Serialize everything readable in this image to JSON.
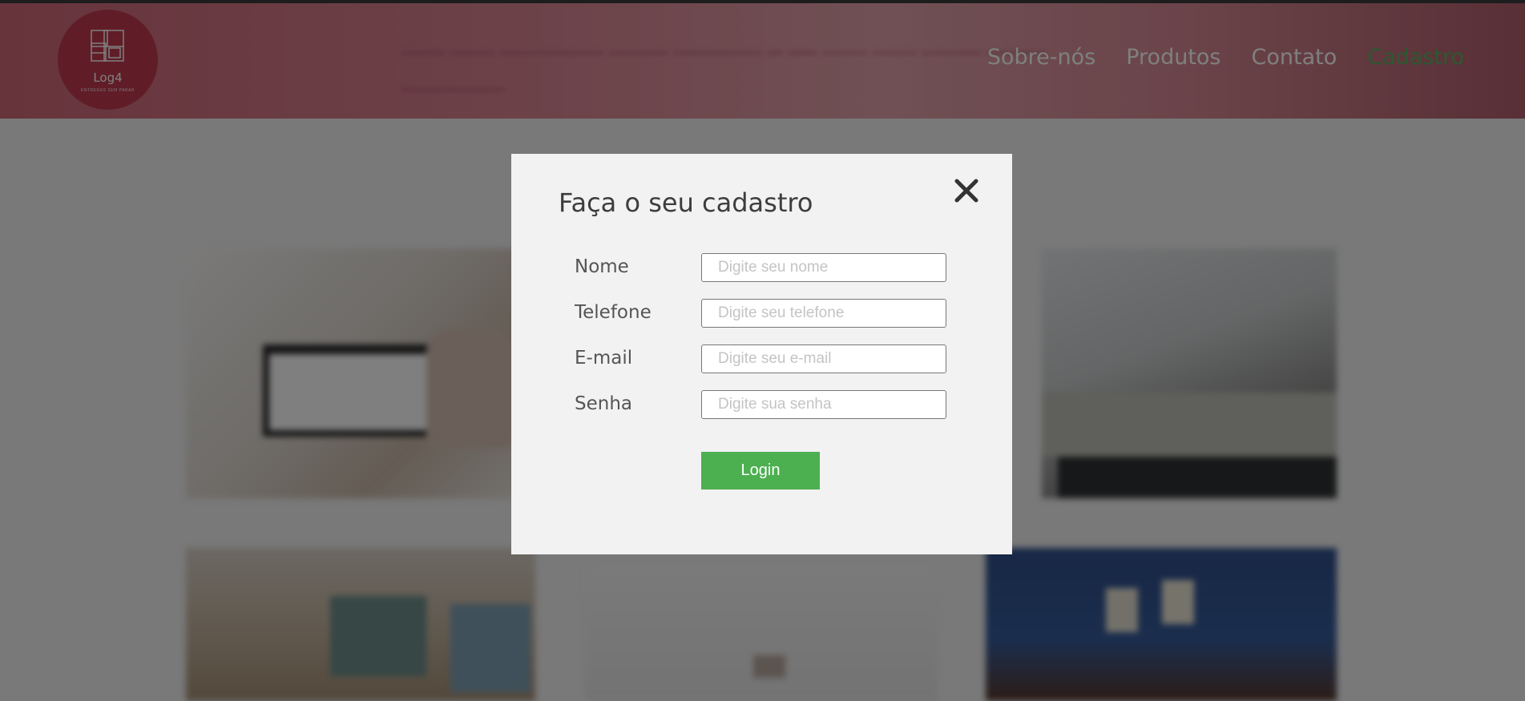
{
  "brand": {
    "name": "Log4",
    "tagline": "ENTREGAS SEM PARAR",
    "color": "#c13b4f"
  },
  "header": {
    "nav": [
      {
        "label": "Sobre-nós",
        "active": false
      },
      {
        "label": "Produtos",
        "active": false
      },
      {
        "label": "Contato",
        "active": false
      },
      {
        "label": "Cadastro",
        "active": true
      }
    ],
    "active_color": "#5fae63"
  },
  "modal": {
    "title": "Faça o seu cadastro",
    "close_icon": "close-icon",
    "fields": [
      {
        "label": "Nome",
        "placeholder": "Digite seu nome",
        "value": ""
      },
      {
        "label": "Telefone",
        "placeholder": "Digite seu telefone",
        "value": ""
      },
      {
        "label": "E-mail",
        "placeholder": "Digite seu e-mail",
        "value": ""
      },
      {
        "label": "Senha",
        "placeholder": "Digite sua senha",
        "value": ""
      }
    ],
    "submit_label": "Login",
    "submit_color": "#4caf50"
  }
}
